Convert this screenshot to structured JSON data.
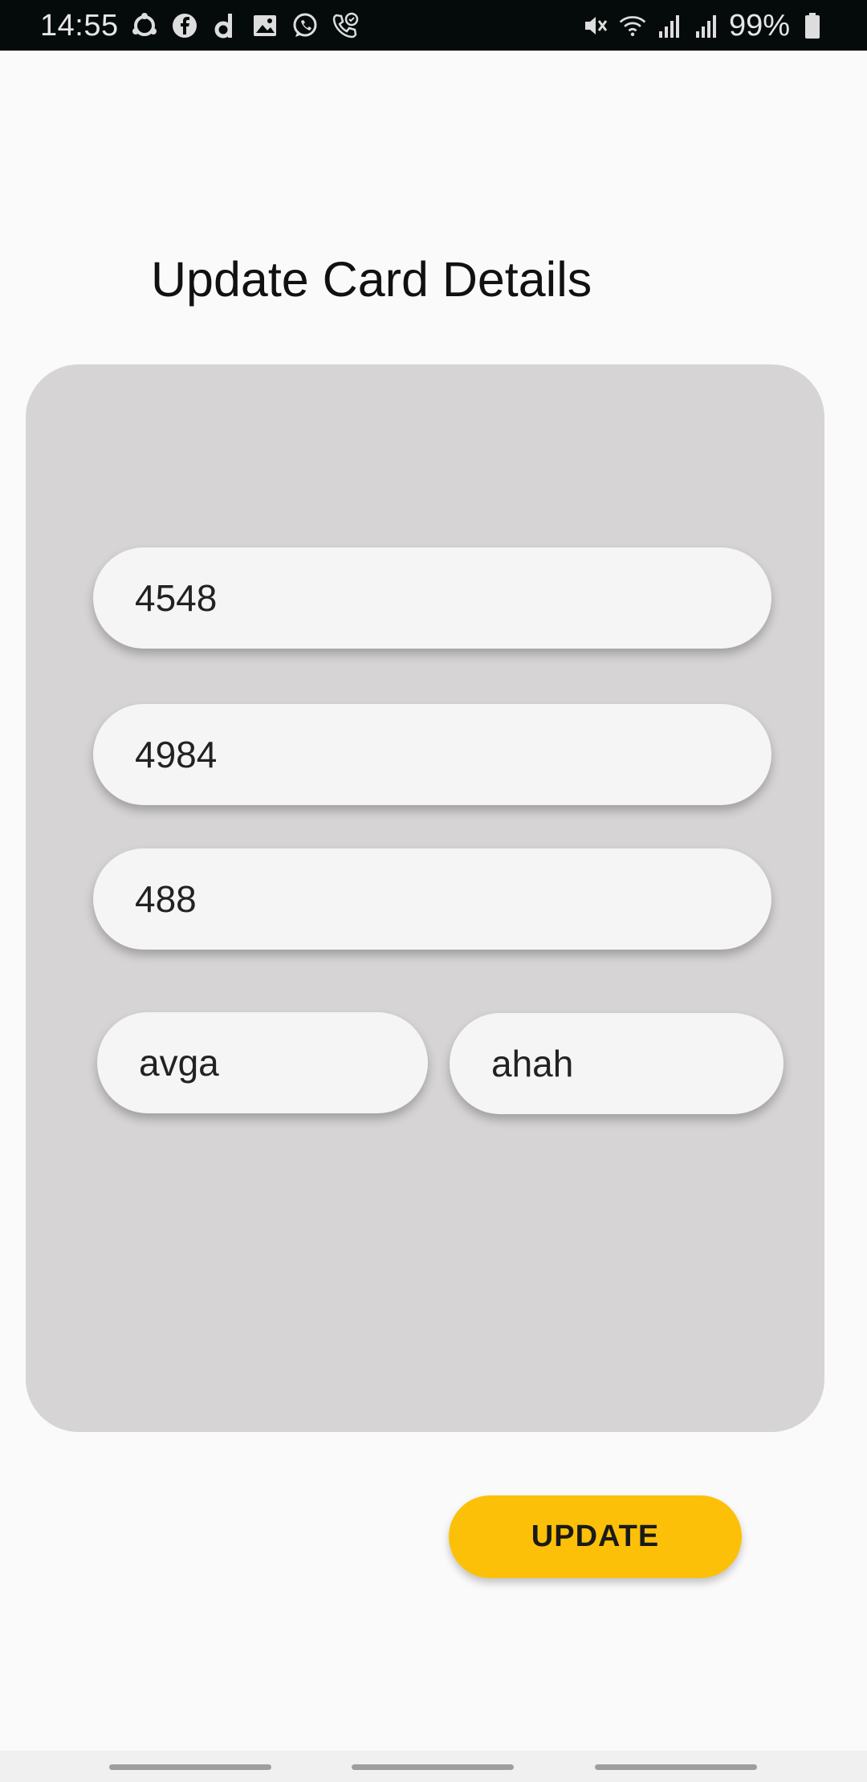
{
  "status_bar": {
    "time": "14:55",
    "battery": "99%",
    "left_icons": [
      "sync-icon",
      "facebook-icon",
      "d-app-icon",
      "gallery-icon",
      "whatsapp-icon",
      "call-icon"
    ],
    "right_icons": [
      "mute-icon",
      "wifi-icon",
      "signal-icon",
      "signal-icon",
      "battery-icon"
    ]
  },
  "header": {
    "title": "Update Card Details"
  },
  "form": {
    "card_number_1": "4548",
    "card_number_2": "4984",
    "cvv": "488",
    "field_left": "avga",
    "field_right": "ahah"
  },
  "actions": {
    "update_label": "UPDATE"
  },
  "colors": {
    "accent": "#fcc009",
    "panel": "#d6d4d5",
    "background": "#fafafa"
  }
}
